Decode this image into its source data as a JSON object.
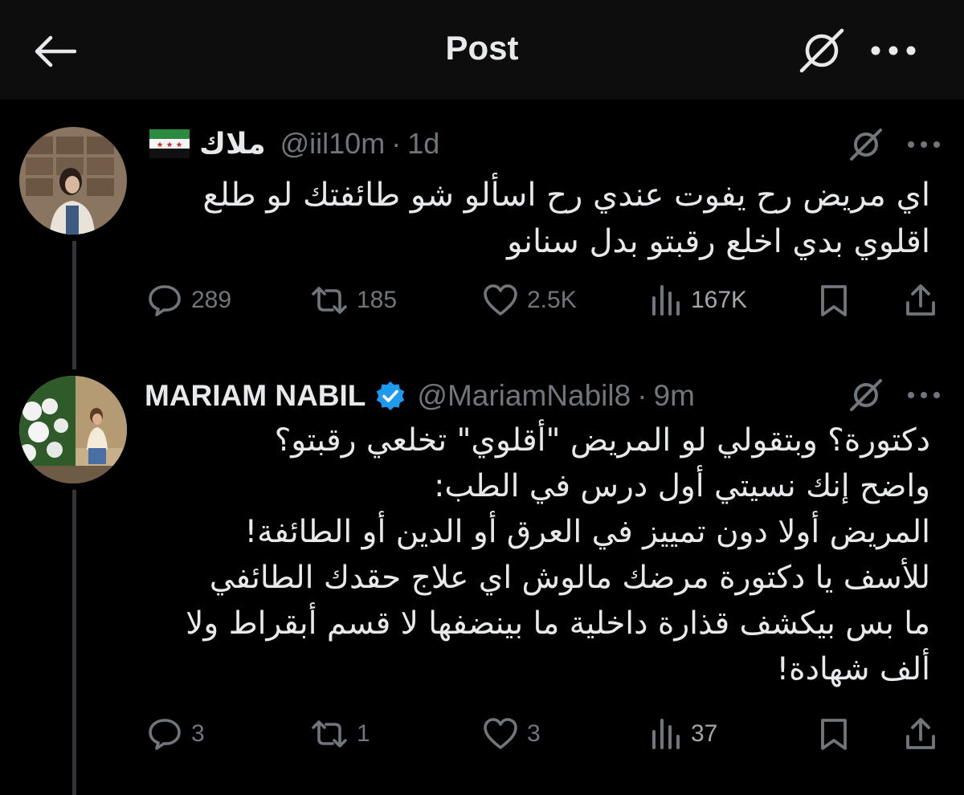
{
  "header": {
    "title": "Post"
  },
  "tweets": [
    {
      "display_name": "ملاك",
      "handle": "@iil10m",
      "separator": "·",
      "time": "1d",
      "verified": false,
      "name_emoji": "syria-independence-flag",
      "text_lines": [
        "اي مريض رح يفوت عندي رح اسألو شو طائفتك لو طلع",
        "اقلوي بدي اخلع رقبتو بدل سنانو"
      ],
      "replies": "289",
      "reposts": "185",
      "likes": "2.5K",
      "views": "167K"
    },
    {
      "display_name": "MARIAM NABIL",
      "handle": "@MariamNabil8",
      "separator": "·",
      "time": "9m",
      "verified": true,
      "text_lines": [
        "دكتورة؟ وبتقولي لو المريض \"أقلوي\" تخلعي رقبتو؟",
        "واضح إنك نسيتي أول درس في الطب:",
        "المريض أولا دون تمييز في العرق أو الدين أو الطائفة!",
        "للأسف يا دكتورة مرضك مالوش اي علاج حقدك الطائفي",
        "ما بس بيكشف قذارة داخلية ما بينضفها لا قسم أبقراط ولا",
        "ألف شهادة!"
      ],
      "replies": "3",
      "reposts": "1",
      "likes": "3",
      "views": "37"
    }
  ],
  "colors": {
    "background": "#000000",
    "topbar": "#0d0d0d",
    "text": "#e7e9ea",
    "muted": "#71767b",
    "verified": "#1d9bf0",
    "thread_line": "#333639"
  }
}
